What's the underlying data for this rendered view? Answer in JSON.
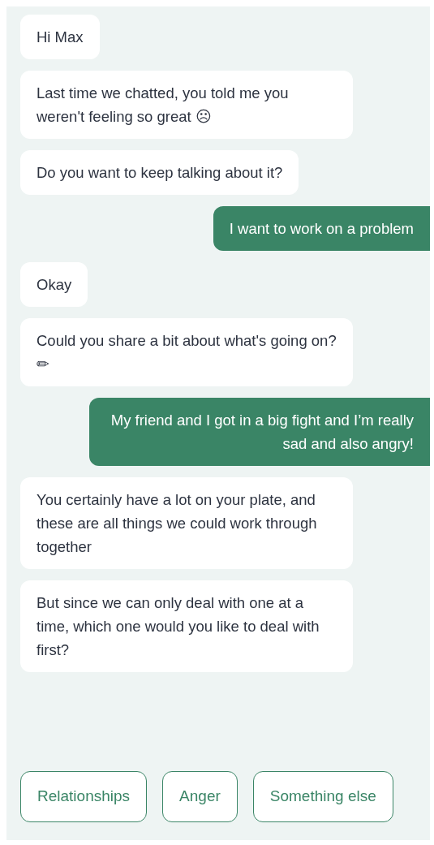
{
  "messages": [
    {
      "kind": "bot",
      "text": "Hi Max"
    },
    {
      "kind": "bot",
      "text": "Last time we chatted, you told me you weren't feeling so great ☹"
    },
    {
      "kind": "bot",
      "text": "Do you want to keep talking about it?"
    },
    {
      "kind": "user",
      "text": "I want to work on a problem"
    },
    {
      "kind": "bot",
      "text": "Okay"
    },
    {
      "kind": "bot",
      "text": "Could you share a bit about what's going on? ✏"
    },
    {
      "kind": "user",
      "text": "My friend and I got in a big fight and I’m really sad and also angry!"
    },
    {
      "kind": "bot",
      "text": "You certainly have a lot on your plate, and these are all things we could work through together"
    },
    {
      "kind": "bot",
      "text": "But since we can only deal with one at a time, which one would you like to deal with first?"
    }
  ],
  "quick_replies": [
    "Relationships",
    "Anger",
    "Something else"
  ]
}
